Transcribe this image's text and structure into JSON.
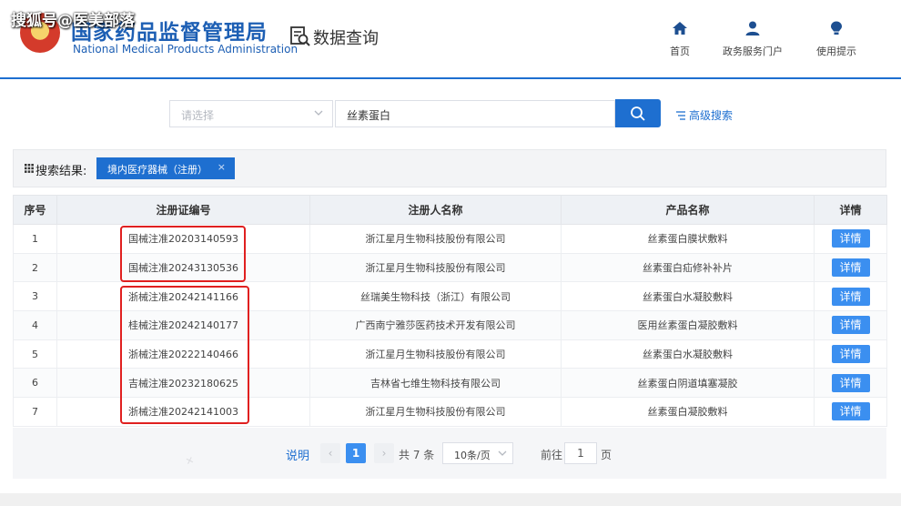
{
  "watermark": "搜狐号@医美部落",
  "header": {
    "org_name_cn": "国家药品监督管理局",
    "org_name_en": "National Medical Products Administration",
    "section_title": "数据查询",
    "nav": [
      {
        "label": "首页",
        "icon": "home-icon"
      },
      {
        "label": "政务服务门户",
        "icon": "user-icon"
      },
      {
        "label": "使用提示",
        "icon": "bulb-icon"
      }
    ]
  },
  "search": {
    "category_placeholder": "请选择",
    "query_value": "丝素蛋白",
    "advanced_label": "高级搜索"
  },
  "results": {
    "label": "搜索结果:",
    "filter_tag": "境内医疗器械（注册）",
    "filter_close": "×"
  },
  "table": {
    "columns": [
      "序号",
      "注册证编号",
      "注册人名称",
      "产品名称",
      "详情"
    ],
    "rows": [
      {
        "no": "1",
        "cert": "国械注准20203140593",
        "registrant": "浙江星月生物科技股份有限公司",
        "product": "丝素蛋白膜状敷料",
        "detail": "详情"
      },
      {
        "no": "2",
        "cert": "国械注准20243130536",
        "registrant": "浙江星月生物科技股份有限公司",
        "product": "丝素蛋白疝修补补片",
        "detail": "详情"
      },
      {
        "no": "3",
        "cert": "浙械注准20242141166",
        "registrant": "丝瑞美生物科技（浙江）有限公司",
        "product": "丝素蛋白水凝胶敷料",
        "detail": "详情"
      },
      {
        "no": "4",
        "cert": "桂械注准20242140177",
        "registrant": "广西南宁雅莎医药技术开发有限公司",
        "product": "医用丝素蛋白凝胶敷料",
        "detail": "详情"
      },
      {
        "no": "5",
        "cert": "浙械注准20222140466",
        "registrant": "浙江星月生物科技股份有限公司",
        "product": "丝素蛋白水凝胶敷料",
        "detail": "详情"
      },
      {
        "no": "6",
        "cert": "吉械注准20232180625",
        "registrant": "吉林省七维生物科技有限公司",
        "product": "丝素蛋白阴道填塞凝胶",
        "detail": "详情"
      },
      {
        "no": "7",
        "cert": "浙械注准20242141003",
        "registrant": "浙江星月生物科技股份有限公司",
        "product": "丝素蛋白凝胶敷料",
        "detail": "详情"
      }
    ]
  },
  "pagination": {
    "note": "说明",
    "prev": "‹",
    "current": "1",
    "next": "›",
    "total": "共 7 条",
    "page_size": "10条/页",
    "goto_label": "前往",
    "goto_value": "1",
    "page_suffix": "页"
  },
  "colors": {
    "primary": "#1e6fd0",
    "detail_button": "#3b8ff0",
    "highlight": "#e02020"
  }
}
